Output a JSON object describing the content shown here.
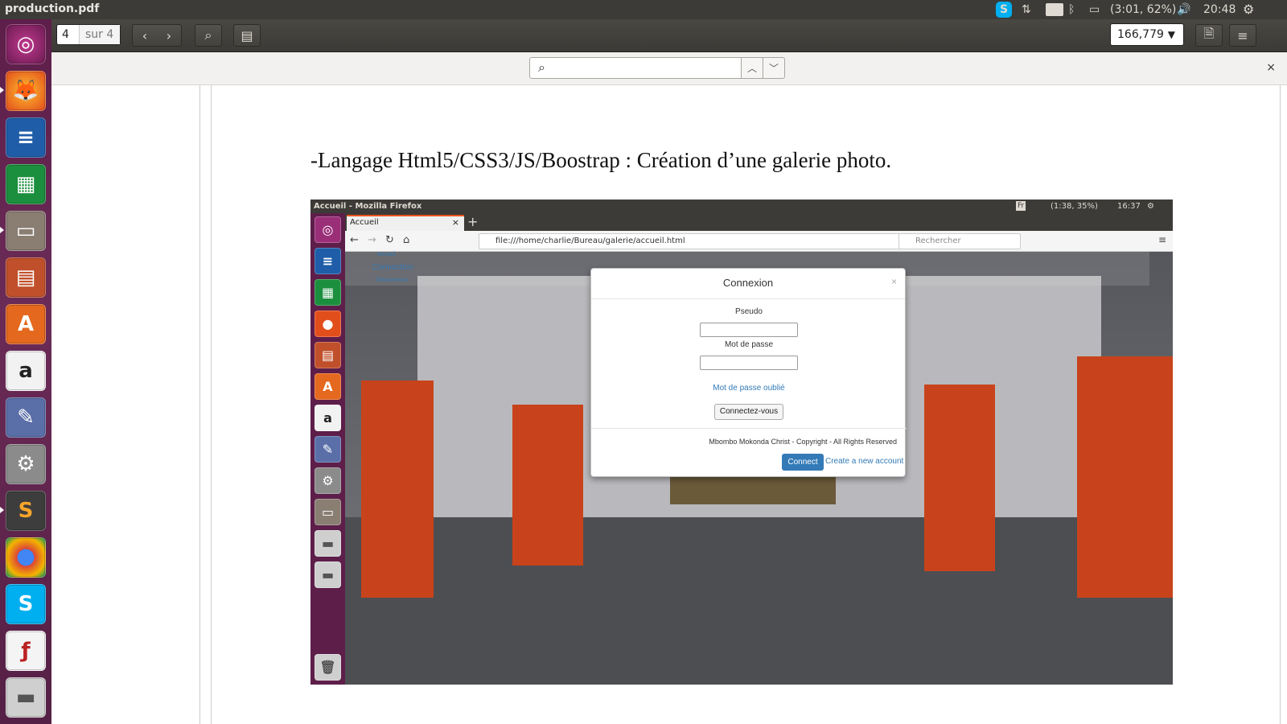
{
  "topbar": {
    "title": "production.pdf",
    "keyboard": "Fr",
    "battery": "(3:01, 62%)",
    "time": "20:48"
  },
  "launcher": {
    "items": [
      "ubuntu-dash",
      "firefox",
      "writer",
      "calc",
      "files",
      "impress",
      "software-center",
      "amazon",
      "gedit",
      "system-settings",
      "sublime-text",
      "chrome",
      "skype",
      "document-viewer",
      "removable-drive"
    ]
  },
  "toolbar": {
    "page_current": "4",
    "page_total": "sur 4",
    "zoom": "166,779"
  },
  "document": {
    "heading": "-Langage Html5/CSS3/JS/Boostrap : Création d’une galerie photo."
  },
  "screenshot": {
    "window_title": "Accueil - Mozilla Firefox",
    "keyboard": "Fr",
    "battery": "(1:38, 35%)",
    "time": "16:37",
    "tab_title": "Accueil",
    "url": "file:///home/charlie/Bureau/galerie/accueil.html",
    "search_placeholder": "Rechercher",
    "nav": {
      "accueil": "Accueil",
      "connection": "Connection",
      "deconnexion": "Déconnexion"
    },
    "modal": {
      "title": "Connexion",
      "pseudo_label": "Pseudo",
      "password_label": "Mot de passe",
      "forgot_link": "Mot de passe oublié",
      "submit": "Connectez-vous",
      "copyright": "Mbombo Mokonda Christ - Copyright - All Rights Reserved",
      "connect": "Connect",
      "create_account": "Create a new account"
    }
  },
  "colors": {
    "launcher": "#5e1e4a",
    "accent": "#e95420",
    "link": "#337ab7",
    "painting": "#c8431b"
  }
}
